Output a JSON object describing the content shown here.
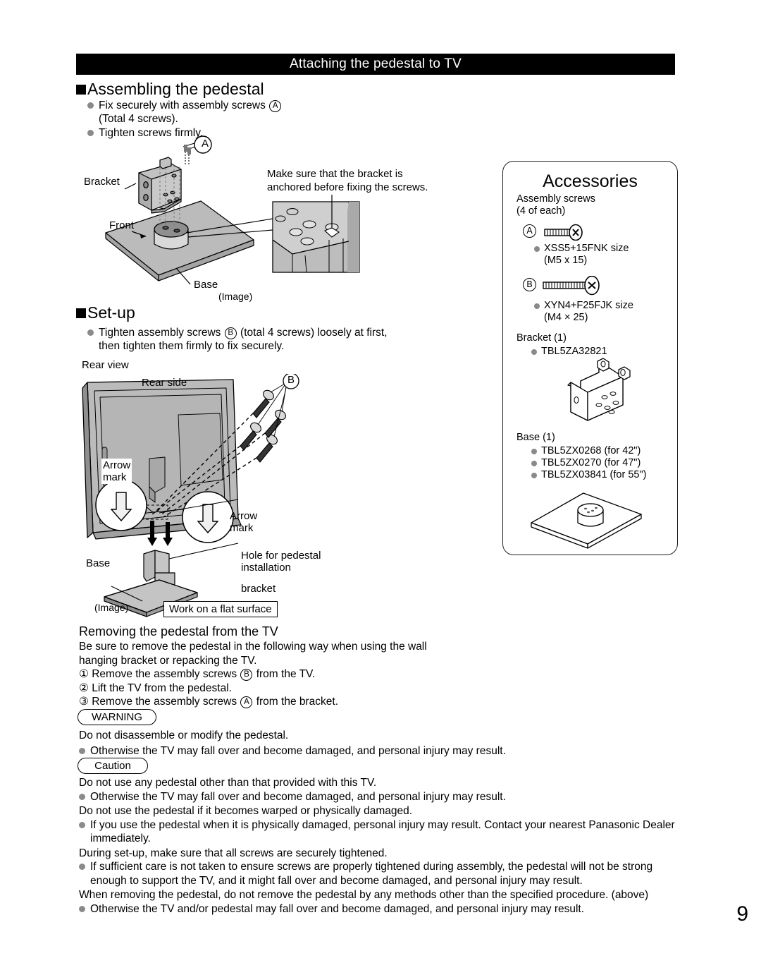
{
  "header": {
    "title": "Attaching the pedestal to TV"
  },
  "section_assemble": {
    "heading": "Assembling the pedestal",
    "bullets": [
      {
        "pre": "Fix securely with assembly screws ",
        "mark": "A",
        "post": "",
        "line2": "(Total 4 screws)."
      },
      {
        "pre": "Tighten screws firmly.",
        "mark": "",
        "post": "",
        "line2": ""
      }
    ],
    "diagram": {
      "callout_a": "A",
      "label_bracket": "Bracket",
      "label_front": "Front",
      "label_base": "Base",
      "label_image": "(Image)",
      "note_line1": "Make sure that the bracket is",
      "note_line2": "anchored before fixing the screws."
    }
  },
  "section_setup": {
    "heading": "Set-up",
    "bullet": {
      "pre": "Tighten assembly screws ",
      "mark": "B",
      "post": " (total 4 screws) loosely at first,",
      "line2": "then tighten them firmly to fix securely."
    },
    "rear_view_label": "Rear view",
    "diagram": {
      "label_rear_side": "Rear side",
      "callout_b": "B",
      "label_arrow_mark_1": "Arrow\nmark",
      "label_arrow_mark_2": "Arrow\nmark",
      "label_hole": "Hole for pedestal\ninstallation",
      "label_bracket": "bracket",
      "label_base": "Base",
      "label_image": "(Image)",
      "flat_surface_note": "Work on a flat surface"
    }
  },
  "accessories": {
    "title": "Accessories",
    "screws_heading_l1": "Assembly screws",
    "screws_heading_l2": "(4 of each)",
    "item_a": {
      "mark": "A",
      "spec_l1": "XSS5+15FNK size",
      "spec_l2": "(M5 x 15)"
    },
    "item_b": {
      "mark": "B",
      "spec_l1": "XYN4+F25FJK size",
      "spec_l2": "(M4 × 25)"
    },
    "bracket_heading": "Bracket (1)",
    "bracket_part": "TBL5ZA32821",
    "base_heading": "Base (1)",
    "base_parts": [
      "TBL5ZX0268 (for 42\")",
      "TBL5ZX0270 (for 47\")",
      "TBL5ZX03841 (for 55\")"
    ]
  },
  "removing": {
    "heading": "Removing the pedestal from the TV",
    "intro_l1": "Be sure to remove the pedestal in the following way when using the wall",
    "intro_l2": "hanging bracket or repacking the TV.",
    "steps": [
      {
        "num": "①",
        "pre": "Remove the assembly screws ",
        "mark": "B",
        "post": " from the TV."
      },
      {
        "num": "②",
        "pre": "Lift the TV from the pedestal.",
        "mark": "",
        "post": ""
      },
      {
        "num": "③",
        "pre": "Remove the assembly screws ",
        "mark": "A",
        "post": " from the bracket."
      }
    ]
  },
  "warning": {
    "label": "WARNING",
    "statement": "Do not disassemble or modify the pedestal.",
    "bullet": "Otherwise the TV may fall over and become damaged, and personal injury may result."
  },
  "caution": {
    "label": "Caution",
    "blocks": [
      {
        "statement": "Do not use any pedestal other than that provided with this TV.",
        "bullet": "Otherwise the TV may fall over and become damaged, and personal injury may result."
      },
      {
        "statement": "Do not use the pedestal if it becomes warped or physically damaged.",
        "bullet": "If you use the pedestal when it is physically damaged, personal injury may result. Contact your nearest Panasonic Dealer immediately."
      },
      {
        "statement": "During set-up, make sure that all screws are securely tightened.",
        "bullet": "If sufficient care is not taken to ensure screws are properly tightened during assembly, the pedestal will not be strong enough to support the TV, and it might fall over and become damaged, and personal injury may result."
      },
      {
        "statement": "When removing the pedestal, do not remove the pedestal by any methods other than the specified procedure. (above)",
        "bullet": "Otherwise the TV and/or pedestal may fall over and become damaged, and personal injury may result."
      }
    ]
  },
  "footer": {
    "page_number": "9"
  },
  "colors": {
    "header_bg": "#000000",
    "bullet_dot": "#8a8a8a",
    "diagram_gray": "#bbbbbb",
    "diagram_gray_dark": "#9a9a9a",
    "diagram_gray_light": "#d6d6d6"
  }
}
